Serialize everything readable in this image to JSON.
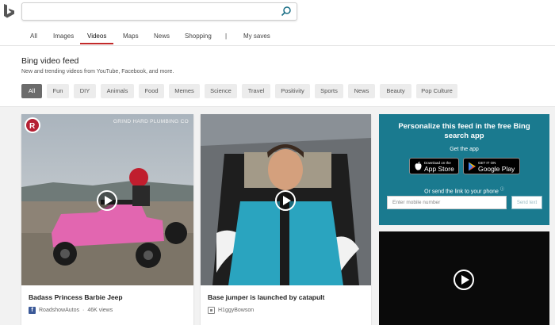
{
  "search": {
    "value": "",
    "placeholder": ""
  },
  "scopes": [
    {
      "label": "All"
    },
    {
      "label": "Images"
    },
    {
      "label": "Videos"
    },
    {
      "label": "Maps"
    },
    {
      "label": "News"
    },
    {
      "label": "Shopping"
    },
    {
      "label": "|"
    },
    {
      "label": "My saves"
    }
  ],
  "active_scope": "Videos",
  "feed": {
    "title": "Bing video feed",
    "subtitle": "New and trending videos from YouTube, Facebook, and more.",
    "chips": [
      "All",
      "Fun",
      "DIY",
      "Animals",
      "Food",
      "Memes",
      "Science",
      "Travel",
      "Positivity",
      "Sports",
      "News",
      "Beauty",
      "Pop Culture"
    ],
    "active_chip": "All"
  },
  "cards": [
    {
      "watermark": "GRIND HARD PLUMBING CO",
      "title": "Badass Princess Barbie Jeep",
      "source": "RoadshowAutos",
      "views": "46K views",
      "source_icon": "facebook-icon"
    },
    {
      "title": "Base jumper is launched by catapult",
      "source": "H1ggyBowson",
      "source_icon": "generic-source-icon"
    }
  ],
  "promo": {
    "title": "Personalize this feed in the free Bing search app",
    "get_app": "Get the app",
    "app_store_small": "Download on the",
    "app_store_big": "App Store",
    "google_play_small": "GET IT ON",
    "google_play_big": "Google Play",
    "send_text": "Or send the link to your phone",
    "mobile_placeholder": "Enter mobile number",
    "send_button": "Send text"
  },
  "colors": {
    "accent_red": "#c22a2a",
    "promo_teal": "#1a7a8f",
    "chip_active": "#6b6b6b",
    "bing_logo": "#555555"
  }
}
